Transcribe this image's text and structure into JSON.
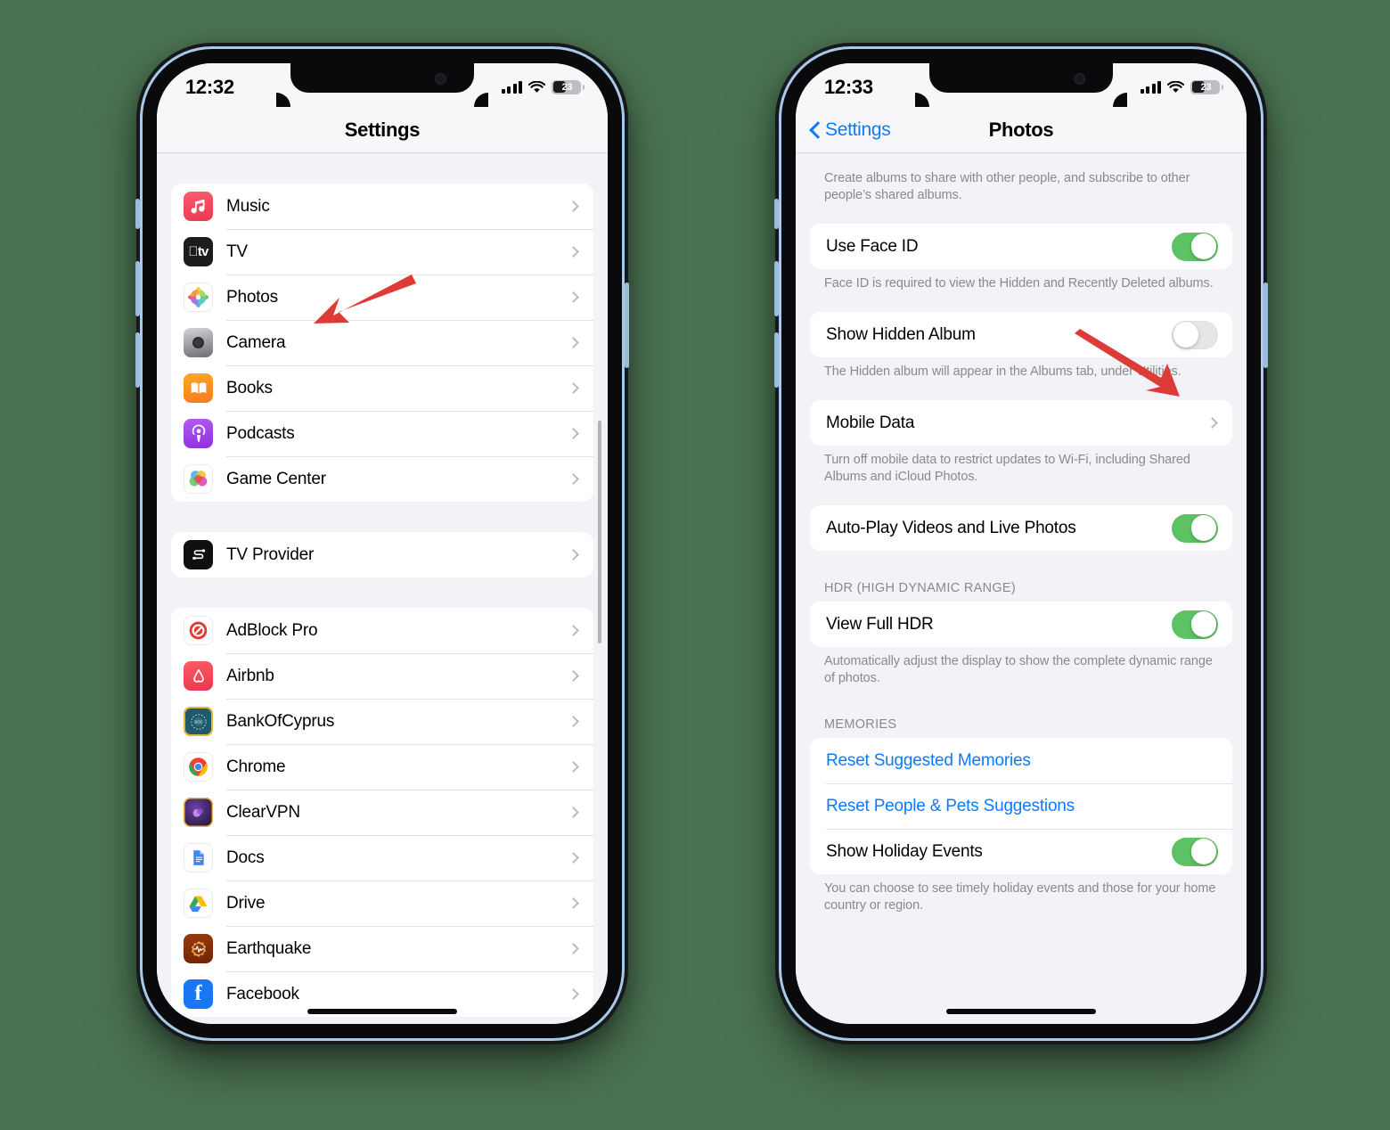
{
  "canvas": {
    "background_color": "#4b7352",
    "accent_blue": "#0a7bff",
    "toggle_on_color": "#5dc264",
    "toggle_off_color": "#e6e6e8",
    "arrow_color": "#dd3b37"
  },
  "left_phone": {
    "status_bar": {
      "time": "12:32",
      "battery_percent": "23",
      "signal_icon": "cellular-bars-icon",
      "wifi_icon": "wifi-icon",
      "battery_icon": "battery-icon"
    },
    "nav": {
      "title": "Settings"
    },
    "groups": [
      {
        "rows": [
          {
            "label": "Music",
            "icon": "music-app-icon",
            "accessory": "chevron"
          },
          {
            "label": "TV",
            "icon": "tv-app-icon",
            "accessory": "chevron"
          },
          {
            "label": "Photos",
            "icon": "photos-app-icon",
            "accessory": "chevron"
          },
          {
            "label": "Camera",
            "icon": "camera-app-icon",
            "accessory": "chevron"
          },
          {
            "label": "Books",
            "icon": "books-app-icon",
            "accessory": "chevron"
          },
          {
            "label": "Podcasts",
            "icon": "podcasts-app-icon",
            "accessory": "chevron"
          },
          {
            "label": "Game Center",
            "icon": "game-center-app-icon",
            "accessory": "chevron"
          }
        ]
      },
      {
        "rows": [
          {
            "label": "TV Provider",
            "icon": "tv-provider-app-icon",
            "accessory": "chevron"
          }
        ]
      },
      {
        "rows": [
          {
            "label": "AdBlock Pro",
            "icon": "adblock-pro-app-icon",
            "accessory": "chevron"
          },
          {
            "label": "Airbnb",
            "icon": "airbnb-app-icon",
            "accessory": "chevron"
          },
          {
            "label": "BankOfCyprus",
            "icon": "bankofcyprus-app-icon",
            "accessory": "chevron"
          },
          {
            "label": "Chrome",
            "icon": "chrome-app-icon",
            "accessory": "chevron"
          },
          {
            "label": "ClearVPN",
            "icon": "clearvpn-app-icon",
            "accessory": "chevron"
          },
          {
            "label": "Docs",
            "icon": "docs-app-icon",
            "accessory": "chevron"
          },
          {
            "label": "Drive",
            "icon": "drive-app-icon",
            "accessory": "chevron"
          },
          {
            "label": "Earthquake",
            "icon": "earthquake-app-icon",
            "accessory": "chevron"
          },
          {
            "label": "Facebook",
            "icon": "facebook-app-icon",
            "accessory": "chevron"
          }
        ]
      }
    ],
    "annotation_arrow": {
      "points_to": "Photos",
      "color": "#dd3b37"
    }
  },
  "right_phone": {
    "status_bar": {
      "time": "12:33",
      "battery_percent": "23",
      "signal_icon": "cellular-bars-icon",
      "wifi_icon": "wifi-icon",
      "battery_icon": "battery-icon"
    },
    "nav": {
      "back_label": "Settings",
      "title": "Photos"
    },
    "sections": [
      {
        "type": "footnote",
        "text": "Create albums to share with other people, and subscribe to other people’s shared albums."
      },
      {
        "type": "group",
        "rows": [
          {
            "label": "Use Face ID",
            "control": "toggle",
            "state": "on"
          }
        ]
      },
      {
        "type": "footnote",
        "text": "Face ID is required to view the Hidden and Recently Deleted albums."
      },
      {
        "type": "group",
        "rows": [
          {
            "label": "Show Hidden Album",
            "control": "toggle",
            "state": "off"
          }
        ]
      },
      {
        "type": "footnote",
        "text": "The Hidden album will appear in the Albums tab, under Utilities."
      },
      {
        "type": "group",
        "rows": [
          {
            "label": "Mobile Data",
            "control": "chevron"
          }
        ]
      },
      {
        "type": "footnote",
        "text": "Turn off mobile data to restrict updates to Wi-Fi, including Shared Albums and iCloud Photos."
      },
      {
        "type": "group",
        "rows": [
          {
            "label": "Auto-Play Videos and Live Photos",
            "control": "toggle",
            "state": "on"
          }
        ]
      },
      {
        "type": "header",
        "text": "HDR (HIGH DYNAMIC RANGE)"
      },
      {
        "type": "group",
        "rows": [
          {
            "label": "View Full HDR",
            "control": "toggle",
            "state": "on"
          }
        ]
      },
      {
        "type": "footnote",
        "text": "Automatically adjust the display to show the complete dynamic range of photos."
      },
      {
        "type": "header",
        "text": "MEMORIES"
      },
      {
        "type": "group",
        "rows": [
          {
            "label": "Reset Suggested Memories",
            "control": "link"
          },
          {
            "label": "Reset People & Pets Suggestions",
            "control": "link"
          },
          {
            "label": "Show Holiday Events",
            "control": "toggle",
            "state": "on"
          }
        ]
      },
      {
        "type": "footnote",
        "text": "You can choose to see timely holiday events and those for your home country or region."
      }
    ],
    "annotation_arrow": {
      "points_to": "Show Hidden Album",
      "color": "#dd3b37"
    }
  }
}
